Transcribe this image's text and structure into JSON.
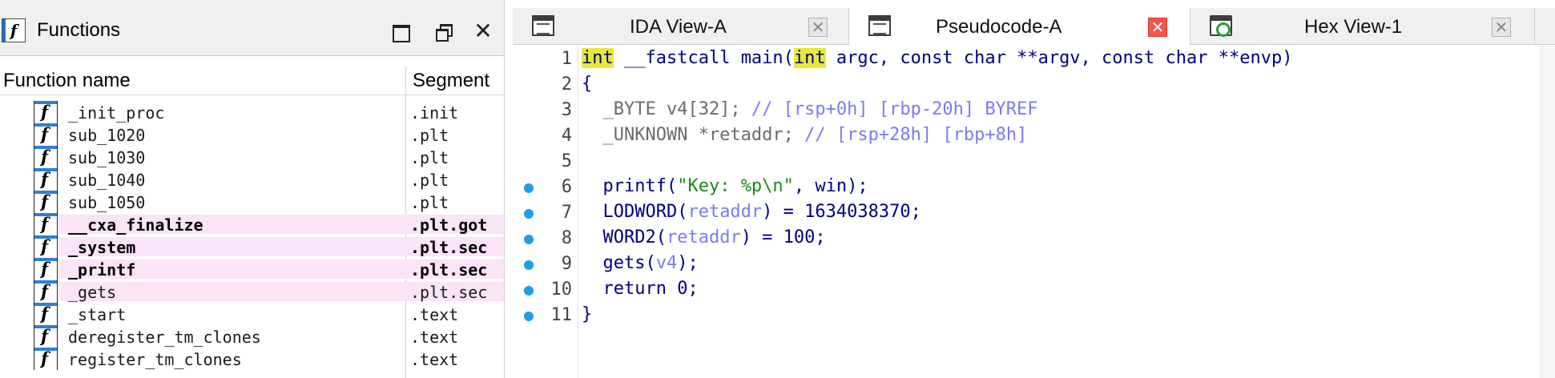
{
  "functions_pane": {
    "title": "Functions",
    "icon_glyph": "f",
    "close_glyph": "✕",
    "columns": {
      "name": "Function name",
      "segment": "Segment"
    },
    "rows": [
      {
        "name": "_init_proc",
        "segment": ".init",
        "highlight": false,
        "bold": false
      },
      {
        "name": "sub_1020",
        "segment": ".plt",
        "highlight": false,
        "bold": false
      },
      {
        "name": "sub_1030",
        "segment": ".plt",
        "highlight": false,
        "bold": false
      },
      {
        "name": "sub_1040",
        "segment": ".plt",
        "highlight": false,
        "bold": false
      },
      {
        "name": "sub_1050",
        "segment": ".plt",
        "highlight": false,
        "bold": false
      },
      {
        "name": "__cxa_finalize",
        "segment": ".plt.got",
        "highlight": true,
        "bold": true
      },
      {
        "name": "_system",
        "segment": ".plt.sec",
        "highlight": true,
        "bold": true
      },
      {
        "name": "_printf",
        "segment": ".plt.sec",
        "highlight": true,
        "bold": true
      },
      {
        "name": "_gets",
        "segment": ".plt.sec",
        "highlight": true,
        "bold": false
      },
      {
        "name": "_start",
        "segment": ".text",
        "highlight": false,
        "bold": false
      },
      {
        "name": "deregister_tm_clones",
        "segment": ".text",
        "highlight": false,
        "bold": false
      },
      {
        "name": "register_tm_clones",
        "segment": ".text",
        "highlight": false,
        "bold": false
      }
    ]
  },
  "tabs": [
    {
      "label": "IDA View-A",
      "icon": "ida-view-icon",
      "active": false,
      "close_glyph": "✕"
    },
    {
      "label": "Pseudocode-A",
      "icon": "pseudocode-icon",
      "active": true,
      "close_glyph": "✕"
    },
    {
      "label": "Hex View-1",
      "icon": "hex-view-icon",
      "active": false,
      "close_glyph": "✕"
    }
  ],
  "pseudocode": {
    "lines": [
      {
        "num": "1",
        "dot": false,
        "segments": [
          {
            "t": "int",
            "c": "kwhl"
          },
          {
            "t": " __fastcall main(",
            "c": ""
          },
          {
            "t": "int",
            "c": "kwhl"
          },
          {
            "t": " argc, const char **argv, const char **envp)",
            "c": ""
          }
        ]
      },
      {
        "num": "2",
        "dot": false,
        "segments": [
          {
            "t": "{",
            "c": ""
          }
        ]
      },
      {
        "num": "3",
        "dot": false,
        "segments": [
          {
            "t": "  _BYTE v4[32]; ",
            "c": "gray"
          },
          {
            "t": "// [rsp+0h] [rbp-20h] BYREF",
            "c": "cmt"
          }
        ]
      },
      {
        "num": "4",
        "dot": false,
        "segments": [
          {
            "t": "  _UNKNOWN *retaddr; ",
            "c": "gray"
          },
          {
            "t": "// [rsp+28h] [rbp+8h]",
            "c": "cmt"
          }
        ]
      },
      {
        "num": "5",
        "dot": false,
        "segments": [
          {
            "t": "",
            "c": ""
          }
        ]
      },
      {
        "num": "6",
        "dot": true,
        "segments": [
          {
            "t": "  printf(",
            "c": ""
          },
          {
            "t": "\"Key: %p\\n\"",
            "c": "str"
          },
          {
            "t": ", win);",
            "c": ""
          }
        ]
      },
      {
        "num": "7",
        "dot": true,
        "segments": [
          {
            "t": "  LODWORD(",
            "c": ""
          },
          {
            "t": "retaddr",
            "c": "var"
          },
          {
            "t": ") = 1634038370;",
            "c": ""
          }
        ]
      },
      {
        "num": "8",
        "dot": true,
        "segments": [
          {
            "t": "  WORD2(",
            "c": ""
          },
          {
            "t": "retaddr",
            "c": "var"
          },
          {
            "t": ") = 100;",
            "c": ""
          }
        ]
      },
      {
        "num": "9",
        "dot": true,
        "segments": [
          {
            "t": "  gets(",
            "c": ""
          },
          {
            "t": "v4",
            "c": "var"
          },
          {
            "t": ");",
            "c": ""
          }
        ]
      },
      {
        "num": "10",
        "dot": true,
        "segments": [
          {
            "t": "  return 0;",
            "c": ""
          }
        ]
      },
      {
        "num": "11",
        "dot": true,
        "segments": [
          {
            "t": "}",
            "c": ""
          }
        ]
      }
    ]
  },
  "colors": {
    "keyword_highlight": "#e8e83a",
    "code_text": "#000080",
    "comment": "#7b7bf0",
    "string": "#1a8a1a",
    "breakpoint_dot": "#1e9ee6",
    "row_highlight": "#fbe3f8",
    "close_active": "#f2574a"
  }
}
